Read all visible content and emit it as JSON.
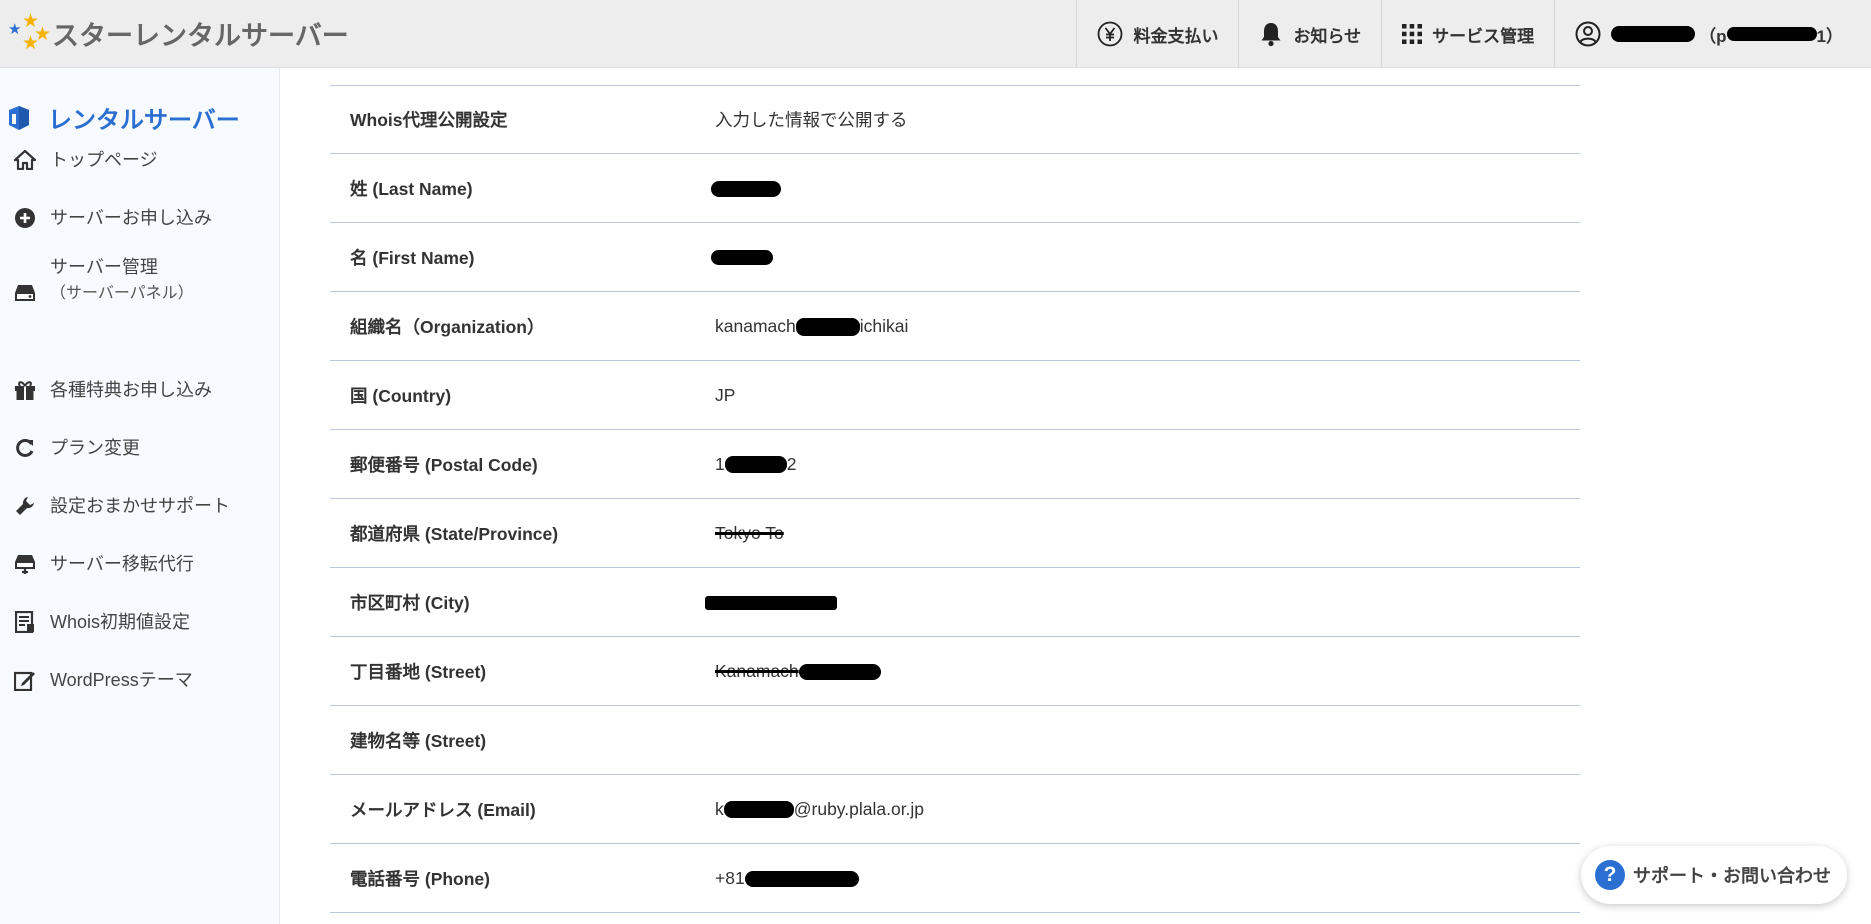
{
  "header": {
    "logo_text": "スターレンタルサーバー",
    "nav": {
      "payment": "料金支払い",
      "notice": "お知らせ",
      "service": "サービス管理",
      "user_prefix": "（p",
      "user_suffix": "1）"
    }
  },
  "sidebar": {
    "title": "レンタルサーバー",
    "items": [
      {
        "label": "トップページ",
        "icon": "home-icon"
      },
      {
        "label": "サーバーお申し込み",
        "icon": "plus-circle-icon"
      },
      {
        "label": "サーバー管理",
        "sub": "（サーバーパネル）",
        "icon": "server-icon"
      },
      {
        "label": "各種特典お申し込み",
        "icon": "gift-icon"
      },
      {
        "label": "プラン変更",
        "icon": "refresh-icon"
      },
      {
        "label": "設定おまかせサポート",
        "icon": "wrench-icon"
      },
      {
        "label": "サーバー移転代行",
        "icon": "server-move-icon"
      },
      {
        "label": "Whois初期値設定",
        "icon": "document-icon"
      },
      {
        "label": "WordPressテーマ",
        "icon": "edit-icon"
      }
    ]
  },
  "table": {
    "rows": [
      {
        "label": "Whois代理公開設定",
        "value": "入力した情報で公開する"
      },
      {
        "label": "姓 (Last Name)",
        "value": ""
      },
      {
        "label": "名 (First Name)",
        "value": ""
      },
      {
        "label": "組織名（Organization）",
        "value_prefix": "kanamach",
        "value_suffix": "ichikai"
      },
      {
        "label": "国 (Country)",
        "value": "JP"
      },
      {
        "label": "郵便番号 (Postal Code)",
        "value_prefix": "1",
        "value_suffix": "2"
      },
      {
        "label": "都道府県 (State/Province)",
        "value": "Tokyo To"
      },
      {
        "label": "市区町村 (City)",
        "value": ""
      },
      {
        "label": "丁目番地 (Street)",
        "value_prefix": "Kanamach",
        "value_suffix": ""
      },
      {
        "label": "建物名等 (Street)",
        "value": ""
      },
      {
        "label": "メールアドレス (Email)",
        "value_prefix": "k",
        "value_suffix": "@ruby.plala.or.jp"
      },
      {
        "label": "電話番号 (Phone)",
        "value_prefix": "+81",
        "value_suffix": ""
      }
    ]
  },
  "support": {
    "label": "サポート・お問い合わせ",
    "icon_glyph": "?"
  },
  "colors": {
    "accent": "#2a6fd1",
    "star": "#f5b300",
    "header_bg": "#ededed",
    "sidebar_bg": "#f7fbff",
    "divider": "#b8c8d8"
  }
}
